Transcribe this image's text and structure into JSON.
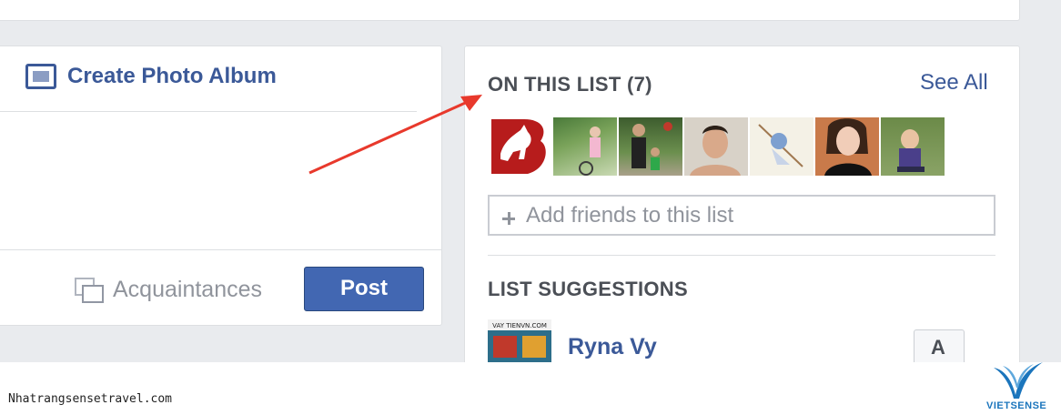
{
  "composer": {
    "create_album_label": "Create Photo Album",
    "audience_label": "Acquaintances",
    "post_label": "Post"
  },
  "sidebar": {
    "on_list_title": "ON THIS LIST (7)",
    "see_all_label": "See All",
    "add_friends_placeholder": "Add friends to this list",
    "suggestions_title": "LIST SUGGESTIONS",
    "suggestion": {
      "name": "Ryna Vy",
      "thumb_caption": "VAY TIENVN.COM",
      "add_button_label": "A"
    }
  },
  "footer": {
    "site_url": "Nhatrangsensetravel.com",
    "brand_name": "VIETSENSE"
  },
  "colors": {
    "link_blue": "#3b5998",
    "button_blue": "#4267b2",
    "annotation_red": "#e8392c"
  }
}
